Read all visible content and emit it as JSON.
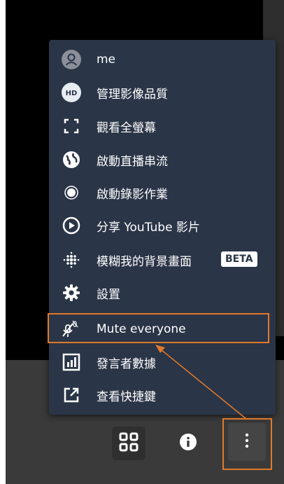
{
  "menu": {
    "items": [
      {
        "id": "me",
        "label": "me",
        "icon": "avatar-icon"
      },
      {
        "id": "quality",
        "label": "管理影像品質",
        "icon": "hd-icon"
      },
      {
        "id": "fullscreen",
        "label": "觀看全螢幕",
        "icon": "fullscreen-icon"
      },
      {
        "id": "stream",
        "label": "啟動直播串流",
        "icon": "globe-icon"
      },
      {
        "id": "record",
        "label": "啟動錄影作業",
        "icon": "record-icon"
      },
      {
        "id": "youtube",
        "label": "分享 YouTube 影片",
        "icon": "play-circle-icon"
      },
      {
        "id": "blur",
        "label": "模糊我的背景畫面",
        "icon": "blur-icon",
        "badge": "BETA"
      },
      {
        "id": "settings",
        "label": "設置",
        "icon": "gear-icon"
      },
      {
        "id": "mute",
        "label": "Mute everyone",
        "icon": "mute-mic-icon"
      },
      {
        "id": "stats",
        "label": "發言者數據",
        "icon": "bar-chart-icon"
      },
      {
        "id": "shortcuts",
        "label": "查看快捷鍵",
        "icon": "external-link-icon"
      }
    ]
  },
  "toolbar": {
    "grid_icon": "grid-view-icon",
    "info_icon": "info-icon",
    "more_icon": "more-vert-icon"
  },
  "colors": {
    "menu_bg": "#2a3547",
    "highlight": "#e07a2c",
    "text": "#ffffff"
  }
}
